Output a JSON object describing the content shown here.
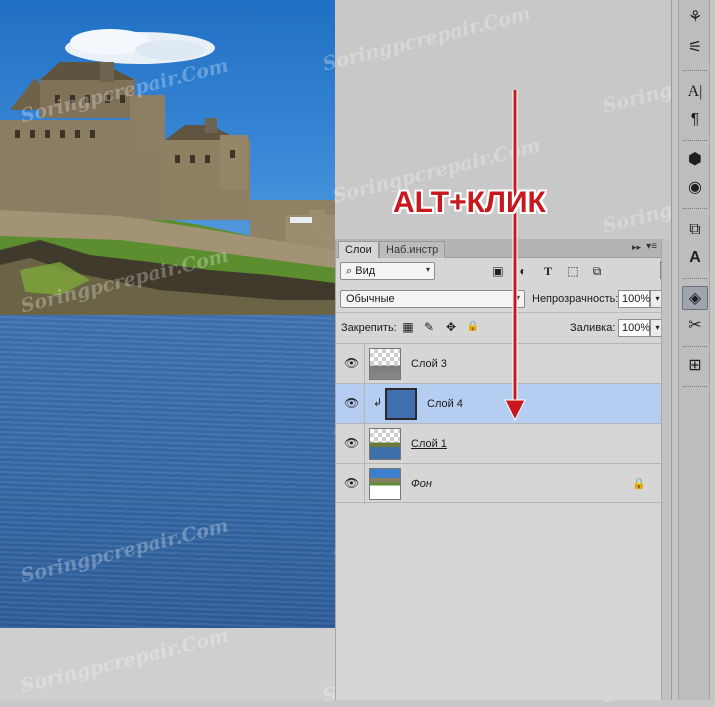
{
  "watermark": "Soringpcrepair.Com",
  "annotation": {
    "label": "ALT+КЛИК",
    "color": "#c8181e"
  },
  "panel": {
    "tabs": [
      "Слои",
      "Наб.инстр"
    ],
    "collapse_glyph": "▸▸",
    "menu_glyph": "▾≡",
    "filter_select": "Вид",
    "blend_mode": "Обычные",
    "opacity_label": "Непрозрачность:",
    "opacity_value": "100%",
    "lock_label": "Закрепить:",
    "fill_label": "Заливка:",
    "fill_value": "100%",
    "layers": [
      {
        "name": "Слой 3",
        "visible": true,
        "selected": false
      },
      {
        "name": "Слой 4",
        "visible": true,
        "selected": true,
        "clipped": true
      },
      {
        "name": "Слой 1",
        "visible": true,
        "selected": false
      },
      {
        "name": "Фон",
        "visible": true,
        "selected": false,
        "locked": true
      }
    ]
  },
  "icons": {
    "eye": "👁",
    "lock": "🔒",
    "clip_arrow": "↲",
    "caret": "▾",
    "search": "⌕",
    "filter_pixel": "▣",
    "filter_adjust": "◐",
    "filter_type": "T",
    "filter_shape": "⬚",
    "filter_smart": "⧉",
    "lock_transparent": "▦",
    "lock_paint": "✎",
    "lock_move": "✥",
    "lock_all": "🔒"
  },
  "toolstrip": [
    {
      "name": "brushes-icon",
      "glyph": "⚘"
    },
    {
      "name": "brush-settings-icon",
      "glyph": "⚟"
    },
    {
      "name": "character-icon",
      "glyph": "A|"
    },
    {
      "name": "paragraph-icon",
      "glyph": "¶"
    },
    {
      "name": "3d-icon",
      "glyph": "⬢"
    },
    {
      "name": "3d-materials-icon",
      "glyph": "◉"
    },
    {
      "name": "clone-source-icon",
      "glyph": "⧉"
    },
    {
      "name": "tool-presets-icon",
      "glyph": "A"
    },
    {
      "name": "layers-icon",
      "glyph": "◈",
      "active": true
    },
    {
      "name": "paths-icon",
      "glyph": "✂"
    },
    {
      "name": "channels-icon",
      "glyph": "⊞"
    }
  ]
}
